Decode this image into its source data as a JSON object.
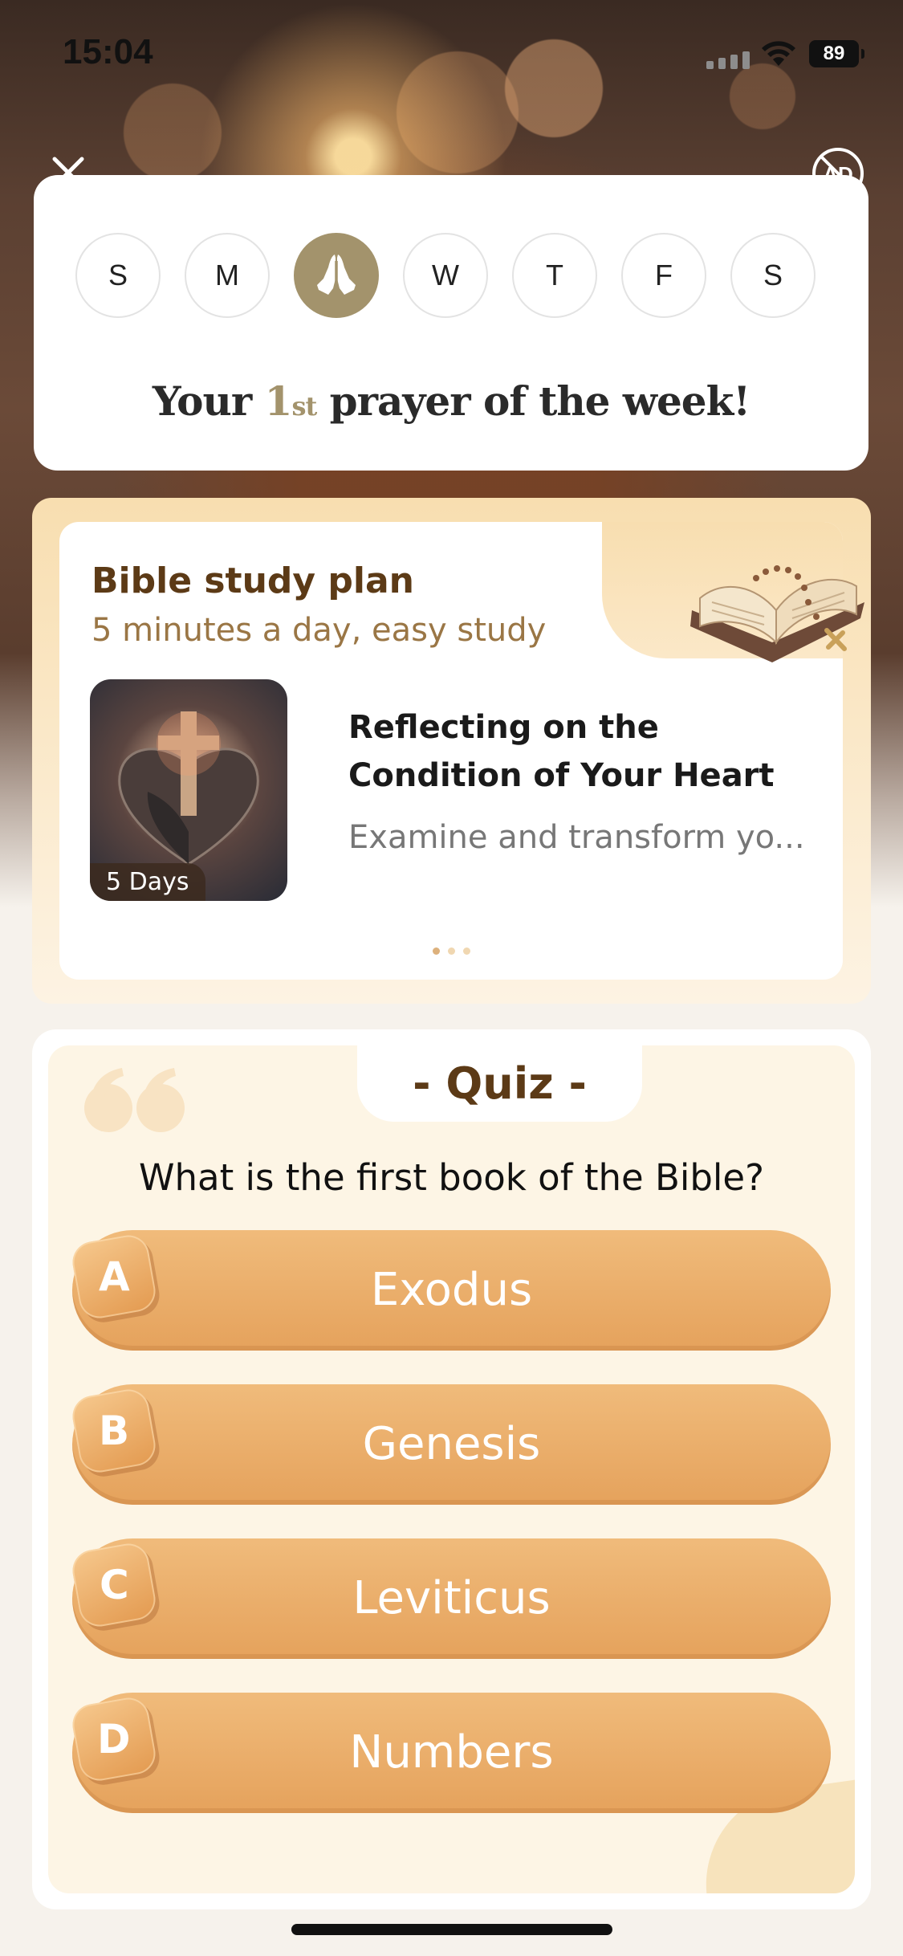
{
  "status_bar": {
    "time": "15:04",
    "battery": "89"
  },
  "week": {
    "days": [
      {
        "label": "S",
        "active": false
      },
      {
        "label": "M",
        "active": false
      },
      {
        "label": "",
        "active": true
      },
      {
        "label": "W",
        "active": false
      },
      {
        "label": "T",
        "active": false
      },
      {
        "label": "F",
        "active": false
      },
      {
        "label": "S",
        "active": false
      }
    ],
    "message_prefix": "Your",
    "message_ordinal_num": "1",
    "message_ordinal_suffix": "st",
    "message_suffix": "prayer of the week!"
  },
  "study": {
    "title": "Bible study plan",
    "subtitle": "5 minutes a day, easy study",
    "item_title": "Reflecting on the Condition of Your Heart",
    "item_desc": "Examine and transform yo...",
    "item_badge": "5 Days",
    "page_count": 3,
    "page_index": 0
  },
  "quiz": {
    "tab": "- Quiz -",
    "question": "What is the first book of the Bible?",
    "options": [
      {
        "letter": "A",
        "label": "Exodus"
      },
      {
        "letter": "B",
        "label": "Genesis"
      },
      {
        "letter": "C",
        "label": "Leviticus"
      },
      {
        "letter": "D",
        "label": "Numbers"
      }
    ]
  },
  "colors": {
    "accent_gold": "#a3936c",
    "brown_text": "#5c3a16",
    "option_orange": "#e5a25c"
  }
}
